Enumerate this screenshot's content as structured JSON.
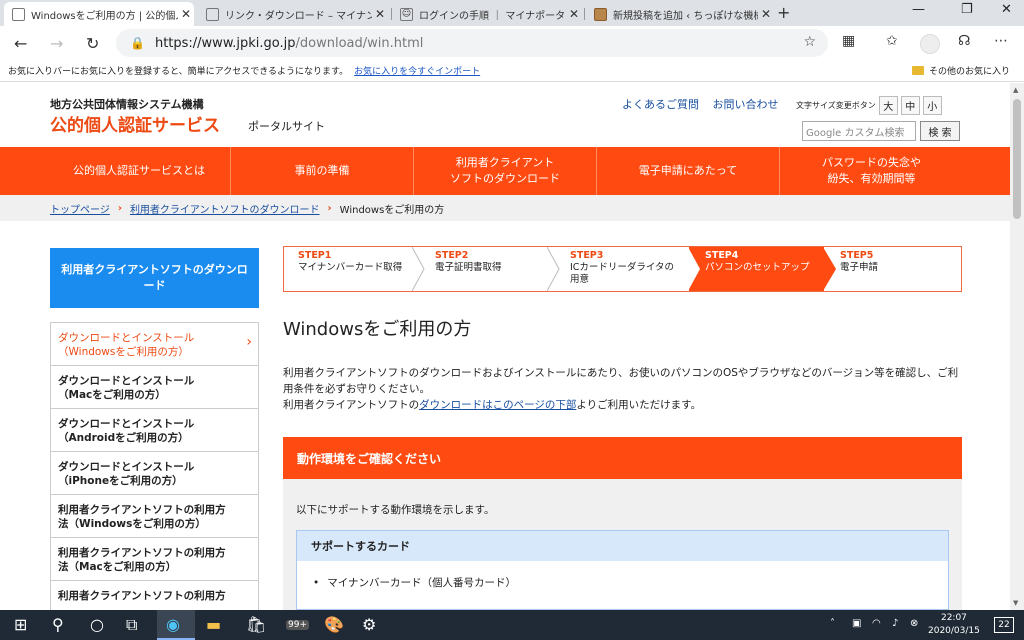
{
  "browser": {
    "tabs": [
      {
        "title": "Windowsをご利用の方 | 公的個人認",
        "active": true
      },
      {
        "title": "リンク・ダウンロード – マイナンバーカード",
        "active": false
      },
      {
        "title": "ログインの手順 ｜ マイナポータル",
        "active": false
      },
      {
        "title": "新規投稿を追加 ‹ ちっぽけな機械技",
        "active": false
      }
    ],
    "url_host": "https://www.jpki.go.jp",
    "url_path": "/download/win.html",
    "favorites_prompt": "お気に入りバーにお気に入りを登録すると、簡単にアクセスできるようになります。",
    "favorites_import_link": "お気に入りを今すぐインポート",
    "favorites_other": "その他のお気に入り"
  },
  "header": {
    "org": "地方公共団体情報システム機構",
    "brand": "公的個人認証サービス",
    "portal": "ポータルサイト",
    "faq": "よくあるご質問",
    "contact": "お問い合わせ",
    "font_size_label": "文字サイズ変更ボタン",
    "font_sizes": [
      "大",
      "中",
      "小"
    ],
    "search_placeholder": "Google カスタム検索",
    "search_button": "検 索"
  },
  "global_nav": [
    "公的個人認証サービスとは",
    "事前の準備",
    "利用者クライアント\nソフトのダウンロード",
    "電子申請にあたって",
    "パスワードの失念や\n紛失、有効期間等"
  ],
  "breadcrumb": [
    "トップページ",
    "利用者クライアントソフトのダウンロード",
    "Windowsをご利用の方"
  ],
  "sidebar": {
    "heading": "利用者クライアントソフトのダウンロード",
    "items": [
      {
        "label": "ダウンロードとインストール\n（Windowsをご利用の方）",
        "active": true
      },
      {
        "label": "ダウンロードとインストール\n（Macをご利用の方）",
        "active": false
      },
      {
        "label": "ダウンロードとインストール\n（Androidをご利用の方）",
        "active": false
      },
      {
        "label": "ダウンロードとインストール\n（iPhoneをご利用の方）",
        "active": false
      },
      {
        "label": "利用者クライアントソフトの利用方\n法（Windowsをご利用の方）",
        "active": false
      },
      {
        "label": "利用者クライアントソフトの利用方\n法（Macをご利用の方）",
        "active": false
      },
      {
        "label": "利用者クライアントソフトの利用方",
        "active": false
      }
    ]
  },
  "steps": [
    {
      "num": "STEP1",
      "label": "マイナンバーカード取得",
      "active": false
    },
    {
      "num": "STEP2",
      "label": "電子証明書取得",
      "active": false
    },
    {
      "num": "STEP3",
      "label": "ICカードリーダライタの\n用意",
      "active": false
    },
    {
      "num": "STEP4",
      "label": "パソコンのセットアップ",
      "active": true
    },
    {
      "num": "STEP5",
      "label": "電子申請",
      "active": false
    }
  ],
  "main": {
    "title": "Windowsをご利用の方",
    "intro_1": "利用者クライアントソフトのダウンロードおよびインストールにあたり、お使いのパソコンのOSやブラウザなどのバージョン等を確認し、ご利用条件を必ずお守りください。",
    "intro_2a": "利用者クライアントソフトの",
    "intro_2link": "ダウンロードはこのページの下部",
    "intro_2b": "よりご利用いただけます。",
    "section_title": "動作環境をご確認ください",
    "section_desc": "以下にサポートする動作環境を示します。",
    "card_heading": "サポートするカード",
    "card_item": "マイナンバーカード（個人番号カード）"
  },
  "taskbar": {
    "store_badge": "99+",
    "time": "22:07",
    "date": "2020/03/15",
    "notifications": "22"
  },
  "colors": {
    "accent": "#ff4b12",
    "sidebar_head": "#1a8cf0",
    "link": "#1a4fa0"
  }
}
